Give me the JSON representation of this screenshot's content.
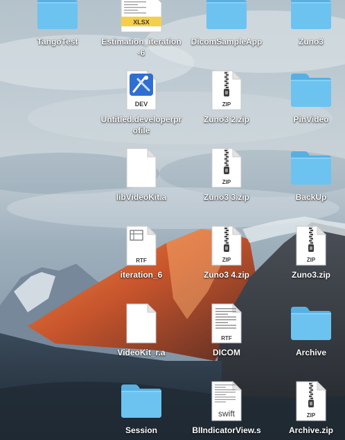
{
  "desktop": {
    "icons": [
      {
        "name": "TangoTest",
        "kind": "folder-icon"
      },
      {
        "name": "Estimation_iteration-6",
        "kind": "xlsx-icon",
        "badge": "XLSX"
      },
      {
        "name": "DicomSampleApp",
        "kind": "folder-icon"
      },
      {
        "name": "Zuno3",
        "kind": "folder-icon"
      },
      {
        "name": "Untitled.developerprofile",
        "kind": "developer-profile-icon",
        "badge": "DEV"
      },
      {
        "name": "Zuno3 2.zip",
        "kind": "zip-icon",
        "badge": "ZIP"
      },
      {
        "name": "PinVideo",
        "kind": "folder-icon"
      },
      {
        "name": "libVideoKit.a",
        "kind": "document-icon"
      },
      {
        "name": "Zuno3 3.zip",
        "kind": "zip-icon",
        "badge": "ZIP"
      },
      {
        "name": "BackUp",
        "kind": "folder-icon"
      },
      {
        "name": "iteration_6",
        "kind": "rtf-icon",
        "badge": "RTF"
      },
      {
        "name": "Zuno3 4.zip",
        "kind": "zip-icon",
        "badge": "ZIP"
      },
      {
        "name": "Zuno3.zip",
        "kind": "zip-icon",
        "badge": "ZIP"
      },
      {
        "name": "VideoKit_r.a",
        "kind": "document-icon"
      },
      {
        "name": "DICOM",
        "kind": "rtf-icon",
        "badge": "RTF"
      },
      {
        "name": "Archive",
        "kind": "folder-icon"
      },
      {
        "name": "Session",
        "kind": "folder-icon"
      },
      {
        "name": "BIIndicatorView.s",
        "kind": "swift-icon",
        "badge": "swift"
      },
      {
        "name": "Archive.zip",
        "kind": "zip-icon",
        "badge": "ZIP"
      }
    ]
  },
  "colors": {
    "folder_front": "#6cc3f0",
    "folder_back": "#57b0e3",
    "label_text": "#ffffff"
  }
}
